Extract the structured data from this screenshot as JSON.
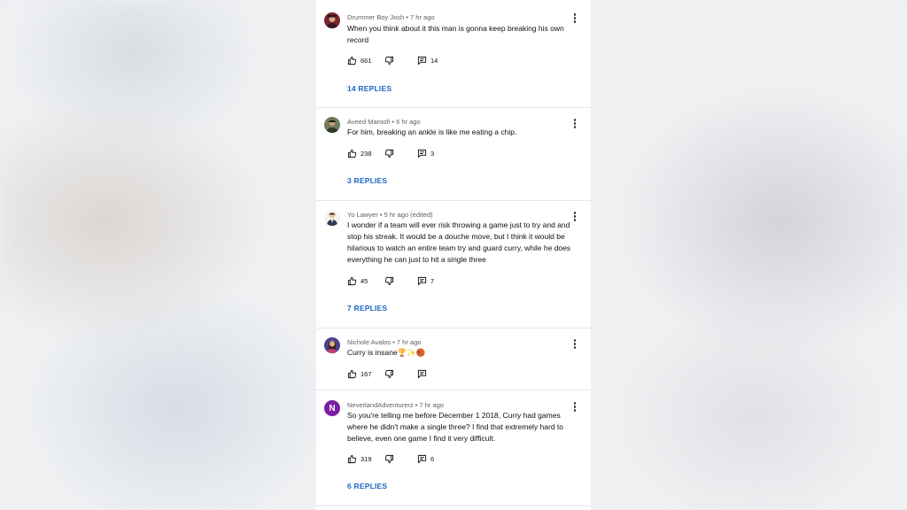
{
  "comments": [
    {
      "author": "Drummer Boy Josh",
      "time": "7 hr ago",
      "text": "When you think about it this man is gonna keep breaking his own record",
      "likes": "661",
      "reply_count": "14",
      "replies_label": "14 REPLIES"
    },
    {
      "author": "Aveed Maroofi",
      "time": "6 hr ago",
      "text": "For him, breaking an ankle is like me eating a chip.",
      "likes": "238",
      "reply_count": "3",
      "replies_label": "3 REPLIES"
    },
    {
      "author": "Yo Lawyer",
      "time": "5 hr ago (edited)",
      "text": "I wonder if a team will ever risk throwing a game just to try and and stop his streak. It would be a douche move, but I think it would be hilarious to watch an entire team try and guard curry, while he does everything he can just to hit a single three",
      "likes": "45",
      "reply_count": "7",
      "replies_label": "7 REPLIES"
    },
    {
      "author": "Nichole Avalos",
      "time": "7 hr ago",
      "text": "Curry  is insane🏆✨🏀",
      "likes": "167",
      "reply_count": "",
      "replies_label": ""
    },
    {
      "author": "NeverlandAdventurerz",
      "time": "7 hr ago",
      "avatar_letter": "N",
      "text": "So you're telling me before December 1 2018, Curry had games where he didn't make a single three? I find that extremely hard to believe, even one game I find it very difficult.",
      "likes": "319",
      "reply_count": "6",
      "replies_label": "6 REPLIES"
    }
  ],
  "separator": "•",
  "colors": {
    "link": "#1967c7",
    "avatar_letter_bg": "#7b1fa2"
  },
  "icons": [
    "thumb-up-icon",
    "thumb-down-icon",
    "reply-icon",
    "more-vert-icon"
  ]
}
